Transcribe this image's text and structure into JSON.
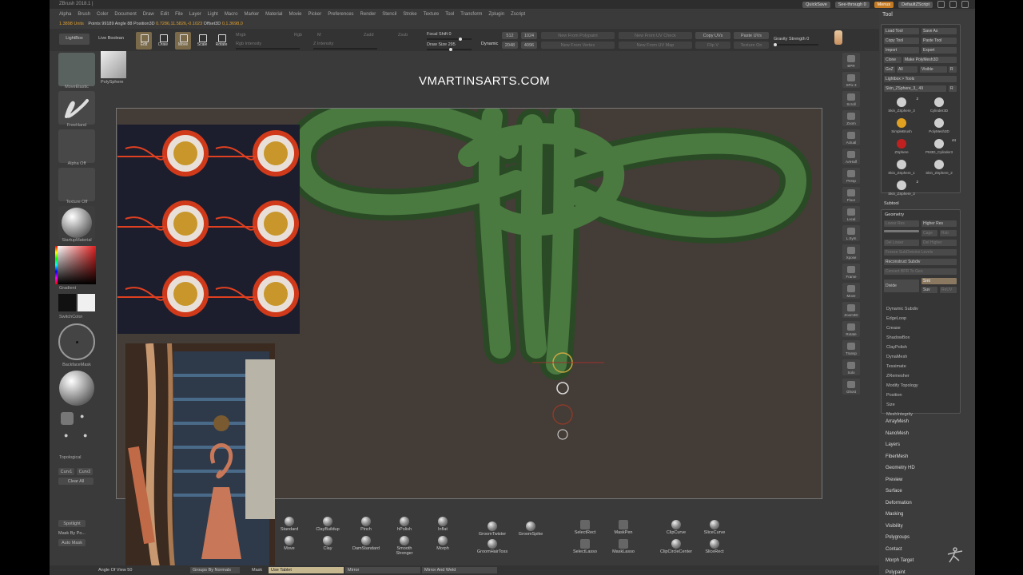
{
  "app": {
    "title": "ZBrush 2018.1 |",
    "menus": [
      "Alpha",
      "Brush",
      "Color",
      "Document",
      "Draw",
      "Edit",
      "File",
      "Layer",
      "Light",
      "Macro",
      "Marker",
      "Material",
      "Movie",
      "Picker",
      "Preferences",
      "Render",
      "Stencil",
      "Stroke",
      "Texture",
      "Tool",
      "Transform",
      "Zplugin",
      "Zscript"
    ],
    "quicksave": "QuickSave",
    "seethrough": "See-through 0",
    "menus_btn": "Menus",
    "script": "DefaultZScript"
  },
  "infobar": {
    "units": "1.3898 Units",
    "points": "Points 99189 Angle 88 Position3D",
    "position": "0.7286,11.5826,-0.1023",
    "offset_label": "Offset3D",
    "offset": "0,1.3698,0"
  },
  "toolbar": {
    "lightbox": "LightBox",
    "live_boolean": "Live Boolean",
    "edit": "Edit",
    "draw": "Draw",
    "move": "Move",
    "scale": "Scale",
    "rotate": "Rotate",
    "focal_shift": "Focal Shift 0",
    "draw_size": "Draw Size 295",
    "dynamic": "Dynamic",
    "rgb_intensity": "Rgb Intensity",
    "z_intensity": "Z Intensity",
    "rgb": "Rgb",
    "zadd": "Zadd",
    "zsub": "Zsub",
    "mrgb": "Mrgb",
    "m": "M",
    "res_512": "512",
    "res_1024": "1024",
    "res_2048": "2048",
    "res_4096": "4096",
    "new_from_polypaint": "New From Polypaint",
    "new_from_uv_check": "New From UV Check",
    "new_from_uv_map": "New From UV Map",
    "new_from_vertex": "New From Vertex",
    "copy_uvs": "Copy UVs",
    "paste_uvs": "Paste UVs",
    "flip_v": "Flip V",
    "texture_on": "Texture On",
    "gravity_strength": "Gravity Strength 0"
  },
  "watermark": "VMARTINSARTS.COM",
  "left_shelf": {
    "brush": "MoveElastic",
    "stroke": "FreeHand",
    "alpha": "Alpha Off",
    "texture": "Texture Off",
    "material": "StartupMaterial",
    "gradient": "Gradient",
    "switch_color": "SwitchColor",
    "backface_mask": "BackfaceMask",
    "topological": "Topological",
    "curv1": "Curv1",
    "curv2": "Curv2",
    "clear_all": "Clear All",
    "spotlight": "Spotlight",
    "mask_by_polygroups": "Mask By Po...",
    "auto_mask": "Auto Mask"
  },
  "poly_sphere": "PolySphere",
  "right_shelf": [
    "BPR",
    "SPix 3",
    "Scroll",
    "Zoom",
    "Actual",
    "AAHalf",
    "Persp",
    "Floor",
    "Local",
    "L.Sym",
    "Xpose",
    "Frame",
    "Move",
    "Zoom3D",
    "Rotate",
    "Transp",
    "Solo",
    "Ghost"
  ],
  "tool_panel": {
    "title": "Tool",
    "load_tool": "Load Tool",
    "save_as": "Save As",
    "copy_tool": "Copy Tool",
    "paste_tool": "Paste Tool",
    "import": "Import",
    "export": "Export",
    "clone": "Clone",
    "make_polymesh": "Make PolyMesh3D",
    "goz": "GoZ",
    "all": "All",
    "visible": "Visible",
    "r": "R",
    "lightbox_tools": "Lightbox > Tools",
    "current_tool": "Skin_ZSphere_3_ 49",
    "current_tool_r": "R",
    "tools": [
      {
        "name": "Skin_ZSphere_3",
        "count": "2"
      },
      {
        "name": "Cylinder3D",
        "count": ""
      },
      {
        "name": "SimpleBrush",
        "count": ""
      },
      {
        "name": "PolyMesh3D",
        "count": ""
      },
      {
        "name": "ZSphere",
        "count": ""
      },
      {
        "name": "PM3D_Cylinder3",
        "count": "44"
      },
      {
        "name": "Skin_ZSphere_1",
        "count": ""
      },
      {
        "name": "Skin_ZSphere_2",
        "count": ""
      },
      {
        "name": "Skin_ZSphere_3",
        "count": "2"
      }
    ],
    "subtool": "Subtool",
    "geometry": "Geometry",
    "lower_res": "Lower Res",
    "higher_res": "Higher Res",
    "sdiv": "SDiv",
    "cage": "Cage",
    "rstr": "Rstr",
    "del_lower": "Del Lower",
    "del_higher": "Del Higher",
    "freeze_subdiv": "Freeze SubDivision Levels",
    "reconstruct_subdiv": "Reconstruct Subdiv",
    "convert_bpr": "Convert BPR To Geo",
    "divide": "Divide",
    "smt": "Smt",
    "suv": "Suv",
    "reuv": "ReUV",
    "sections": [
      "Dynamic Subdiv",
      "EdgeLoop",
      "Crease",
      "ShadowBox",
      "ClayPolish",
      "DynaMesh",
      "Tessimate",
      "ZRemesher",
      "Modify Topology",
      "Position",
      "Size",
      "MeshIntegrity"
    ],
    "menus": [
      "ArrayMesh",
      "NanoMesh",
      "Layers",
      "FiberMesh",
      "Geometry HD",
      "Preview",
      "Surface",
      "Deformation",
      "Masking",
      "Visibility",
      "Polygroups",
      "Contact",
      "Morph Target",
      "Polypaint"
    ]
  },
  "bottom_shelf": {
    "brushes": [
      {
        "name": "Standard"
      },
      {
        "name": "ClayBuildup"
      },
      {
        "name": "Pinch"
      },
      {
        "name": "hPolish"
      },
      {
        "name": "Inflat"
      },
      {
        "name": "Move"
      },
      {
        "name": "Clay"
      },
      {
        "name": "DamStandard"
      },
      {
        "name": "Smooth Stronger"
      },
      {
        "name": "Morph"
      },
      {
        "name": "GroomTwister"
      },
      {
        "name": "GroomSpike"
      },
      {
        "name": "GroomHairToss"
      },
      {
        "name": "SelectRect"
      },
      {
        "name": "MaskPen"
      },
      {
        "name": "SelectLasso"
      },
      {
        "name": "MaskLasso"
      },
      {
        "name": "ClipCurve"
      },
      {
        "name": "SliceCurve"
      },
      {
        "name": "ClipCircleCenter"
      },
      {
        "name": "SliceRect"
      }
    ]
  },
  "bottom_bar": {
    "angle_of_view": "Angle Of View 50",
    "groups_by_normals": "Groups By Normals",
    "mask": "Mask",
    "use_tablet": "Use Tablet",
    "mirror": "Mirror",
    "mirror_and_weld": "Mirror And Weld"
  },
  "colors": {
    "ui_bg": "#3a3a3a",
    "viewport_bg": "#443c36",
    "rope_green": "#3f6b38",
    "accent_orange": "#c47a22"
  }
}
